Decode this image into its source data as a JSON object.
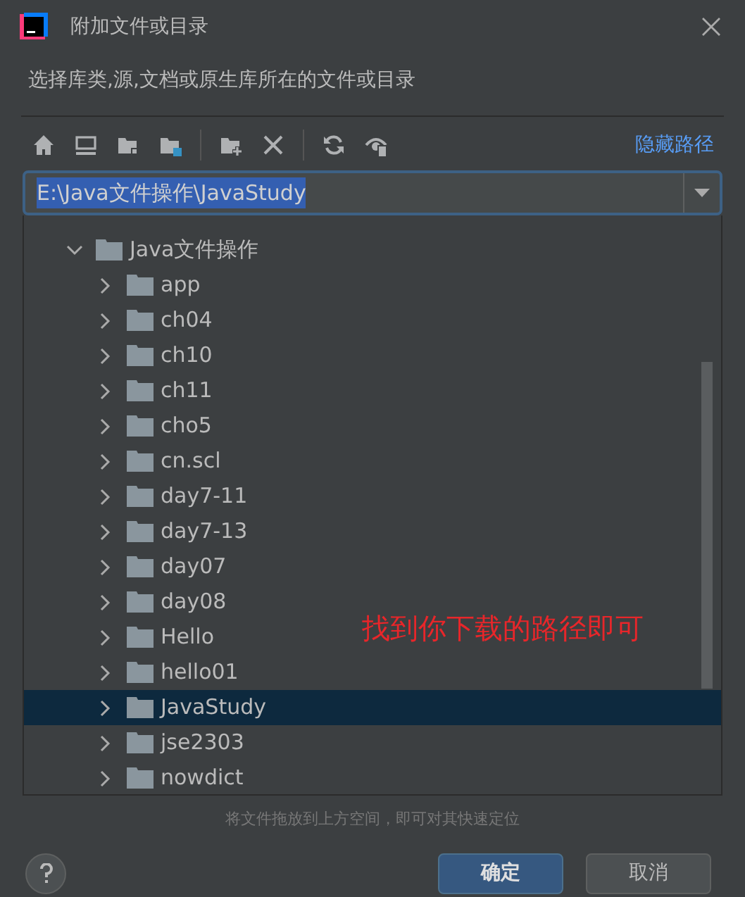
{
  "window": {
    "title": "附加文件或目录"
  },
  "description": "选择库类,源,文档或原生库所在的文件或目录",
  "toolbar": {
    "hide_path_link": "隐藏路径"
  },
  "path_field": {
    "value": "E:\\Java文件操作\\JavaStudy",
    "text_selected": true
  },
  "tree": [
    {
      "label": "Java文件操作",
      "expanded": true,
      "selected": false,
      "children": [
        {
          "label": "app",
          "expanded": false,
          "selected": false
        },
        {
          "label": "ch04",
          "expanded": false,
          "selected": false
        },
        {
          "label": "ch10",
          "expanded": false,
          "selected": false
        },
        {
          "label": "ch11",
          "expanded": false,
          "selected": false
        },
        {
          "label": "cho5",
          "expanded": false,
          "selected": false
        },
        {
          "label": "cn.scl",
          "expanded": false,
          "selected": false
        },
        {
          "label": "day7-11",
          "expanded": false,
          "selected": false
        },
        {
          "label": "day7-13",
          "expanded": false,
          "selected": false
        },
        {
          "label": "day07",
          "expanded": false,
          "selected": false
        },
        {
          "label": "day08",
          "expanded": false,
          "selected": false
        },
        {
          "label": "Hello",
          "expanded": false,
          "selected": false
        },
        {
          "label": "hello01",
          "expanded": false,
          "selected": false
        },
        {
          "label": "JavaStudy",
          "expanded": false,
          "selected": true
        },
        {
          "label": "jse2303",
          "expanded": false,
          "selected": false
        },
        {
          "label": "nowdict",
          "expanded": false,
          "selected": false
        }
      ]
    }
  ],
  "annotation": "找到你下载的路径即可",
  "hint": "将文件拖放到上方空间，即可对其快速定位",
  "buttons": [
    {
      "label": "确定",
      "kind": "primary"
    },
    {
      "label": "取消",
      "kind": "secondary"
    }
  ]
}
